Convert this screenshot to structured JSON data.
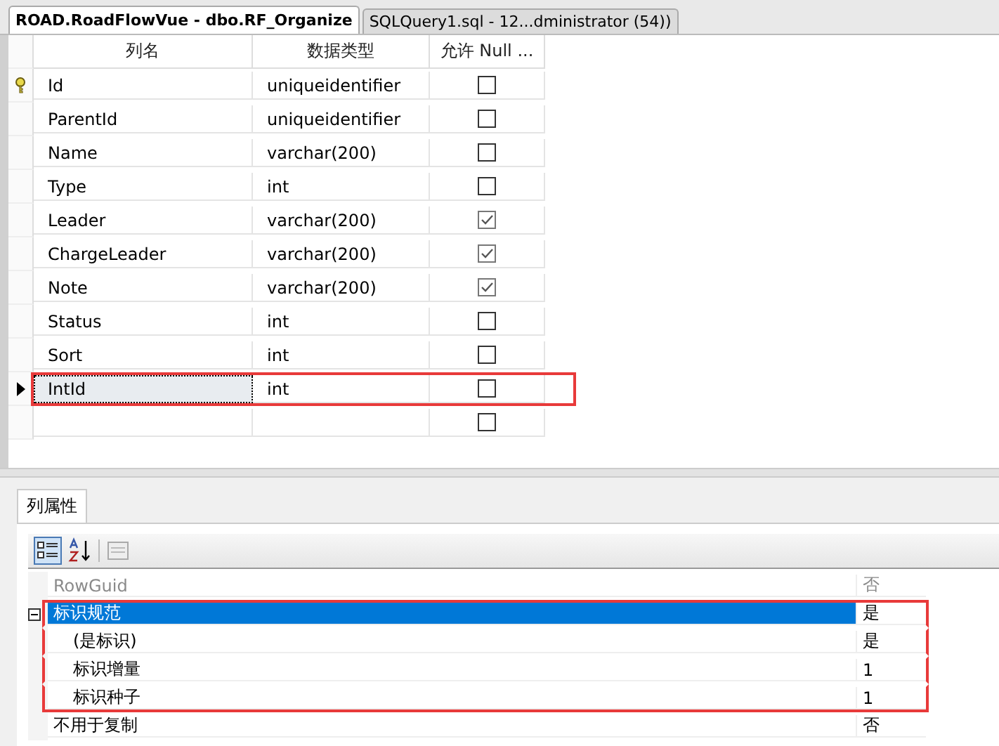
{
  "tabs": [
    {
      "label": "ROAD.RoadFlowVue - dbo.RF_Organize",
      "selected": true
    },
    {
      "label": "SQLQuery1.sql - 12...dministrator (54))",
      "selected": false
    }
  ],
  "table": {
    "columns": [
      "列名",
      "数据类型",
      "允许 Null ..."
    ],
    "rows": [
      {
        "name": "Id",
        "type": "uniqueidentifier",
        "allow_null": false,
        "primary_key": true,
        "selected": false,
        "highlighted": false
      },
      {
        "name": "ParentId",
        "type": "uniqueidentifier",
        "allow_null": false,
        "primary_key": false,
        "selected": false,
        "highlighted": false
      },
      {
        "name": "Name",
        "type": "varchar(200)",
        "allow_null": false,
        "primary_key": false,
        "selected": false,
        "highlighted": false
      },
      {
        "name": "Type",
        "type": "int",
        "allow_null": false,
        "primary_key": false,
        "selected": false,
        "highlighted": false
      },
      {
        "name": "Leader",
        "type": "varchar(200)",
        "allow_null": true,
        "primary_key": false,
        "selected": false,
        "highlighted": false
      },
      {
        "name": "ChargeLeader",
        "type": "varchar(200)",
        "allow_null": true,
        "primary_key": false,
        "selected": false,
        "highlighted": false
      },
      {
        "name": "Note",
        "type": "varchar(200)",
        "allow_null": true,
        "primary_key": false,
        "selected": false,
        "highlighted": false
      },
      {
        "name": "Status",
        "type": "int",
        "allow_null": false,
        "primary_key": false,
        "selected": false,
        "highlighted": false
      },
      {
        "name": "Sort",
        "type": "int",
        "allow_null": false,
        "primary_key": false,
        "selected": false,
        "highlighted": false
      },
      {
        "name": "IntId",
        "type": "int",
        "allow_null": false,
        "primary_key": false,
        "selected": true,
        "highlighted": true
      }
    ],
    "new_row": {
      "allow_null": false
    }
  },
  "properties_panel": {
    "tab": "列属性",
    "rows": [
      {
        "kind": "item",
        "name": "RowGuid",
        "value": "否",
        "disabled": true,
        "selected": false,
        "highlighted": false
      },
      {
        "kind": "category",
        "name": "标识规范",
        "value": "是",
        "expanded": true,
        "disabled": false,
        "selected": true,
        "highlighted": true
      },
      {
        "kind": "child",
        "name": "(是标识)",
        "value": "是",
        "disabled": false,
        "selected": false,
        "highlighted": true
      },
      {
        "kind": "child",
        "name": "标识增量",
        "value": "1",
        "disabled": false,
        "selected": false,
        "highlighted": true
      },
      {
        "kind": "child",
        "name": "标识种子",
        "value": "1",
        "disabled": false,
        "selected": false,
        "highlighted": true
      },
      {
        "kind": "item",
        "name": "不用于复制",
        "value": "否",
        "disabled": false,
        "selected": false,
        "highlighted": false
      }
    ]
  }
}
